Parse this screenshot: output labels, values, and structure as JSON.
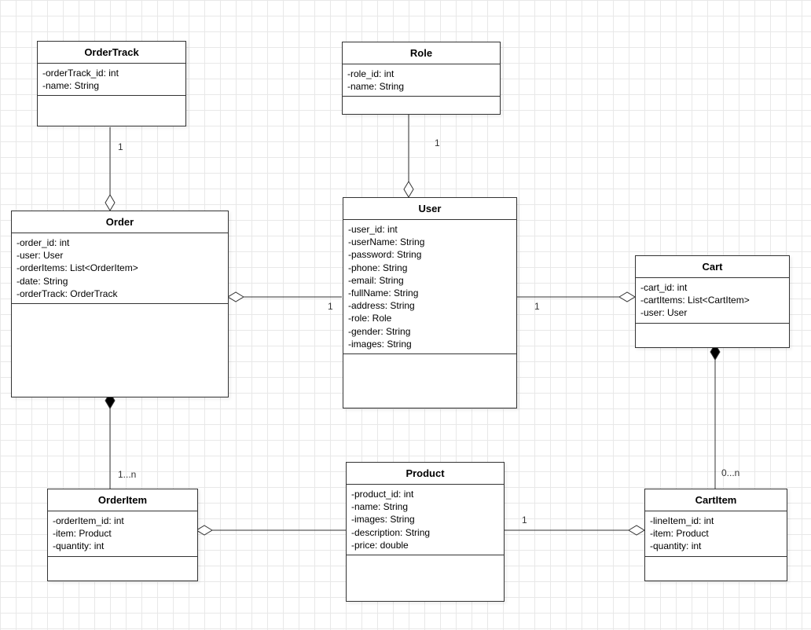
{
  "diagram_type": "UML Class Diagram",
  "classes": {
    "OrderTrack": {
      "name": "OrderTrack",
      "attributes": "-orderTrack_id: int\n-name: String"
    },
    "Role": {
      "name": "Role",
      "attributes": "-role_id: int\n-name: String"
    },
    "Order": {
      "name": "Order",
      "attributes": "-order_id: int\n-user: User\n-orderItems: List<OrderItem>\n-date: String\n-orderTrack: OrderTrack"
    },
    "User": {
      "name": "User",
      "attributes": "-user_id: int\n-userName: String\n-password: String\n-phone: String\n-email: String\n-fullName: String\n-address: String\n-role: Role\n-gender: String\n-images: String"
    },
    "Cart": {
      "name": "Cart",
      "attributes": "-cart_id: int\n-cartItems: List<CartItem>\n-user: User"
    },
    "OrderItem": {
      "name": "OrderItem",
      "attributes": "-orderItem_id: int\n-item: Product\n-quantity: int"
    },
    "Product": {
      "name": "Product",
      "attributes": "-product_id: int\n-name: String\n-images: String\n-description: String\n-price: double"
    },
    "CartItem": {
      "name": "CartItem",
      "attributes": "-lineItem_id: int\n-item: Product\n-quantity: int"
    }
  },
  "multiplicities": {
    "ordertrack_order": "1",
    "role_user": "1",
    "order_user": "1",
    "user_cart": "1",
    "order_orderitem": "1...n",
    "product_orderitem": "1",
    "cart_cartitem": "0...n"
  },
  "relationships": [
    {
      "from": "Order",
      "to": "OrderTrack",
      "type": "aggregation",
      "whole": "Order"
    },
    {
      "from": "Order",
      "to": "User",
      "type": "aggregation",
      "whole": "Order"
    },
    {
      "from": "Cart",
      "to": "User",
      "type": "aggregation",
      "whole": "Cart"
    },
    {
      "from": "User",
      "to": "Role",
      "type": "aggregation",
      "whole": "User"
    },
    {
      "from": "Order",
      "to": "OrderItem",
      "type": "composition",
      "whole": "Order"
    },
    {
      "from": "Cart",
      "to": "CartItem",
      "type": "composition",
      "whole": "Cart"
    },
    {
      "from": "OrderItem",
      "to": "Product",
      "type": "aggregation",
      "whole": "OrderItem"
    },
    {
      "from": "CartItem",
      "to": "Product",
      "type": "aggregation",
      "whole": "CartItem"
    }
  ]
}
